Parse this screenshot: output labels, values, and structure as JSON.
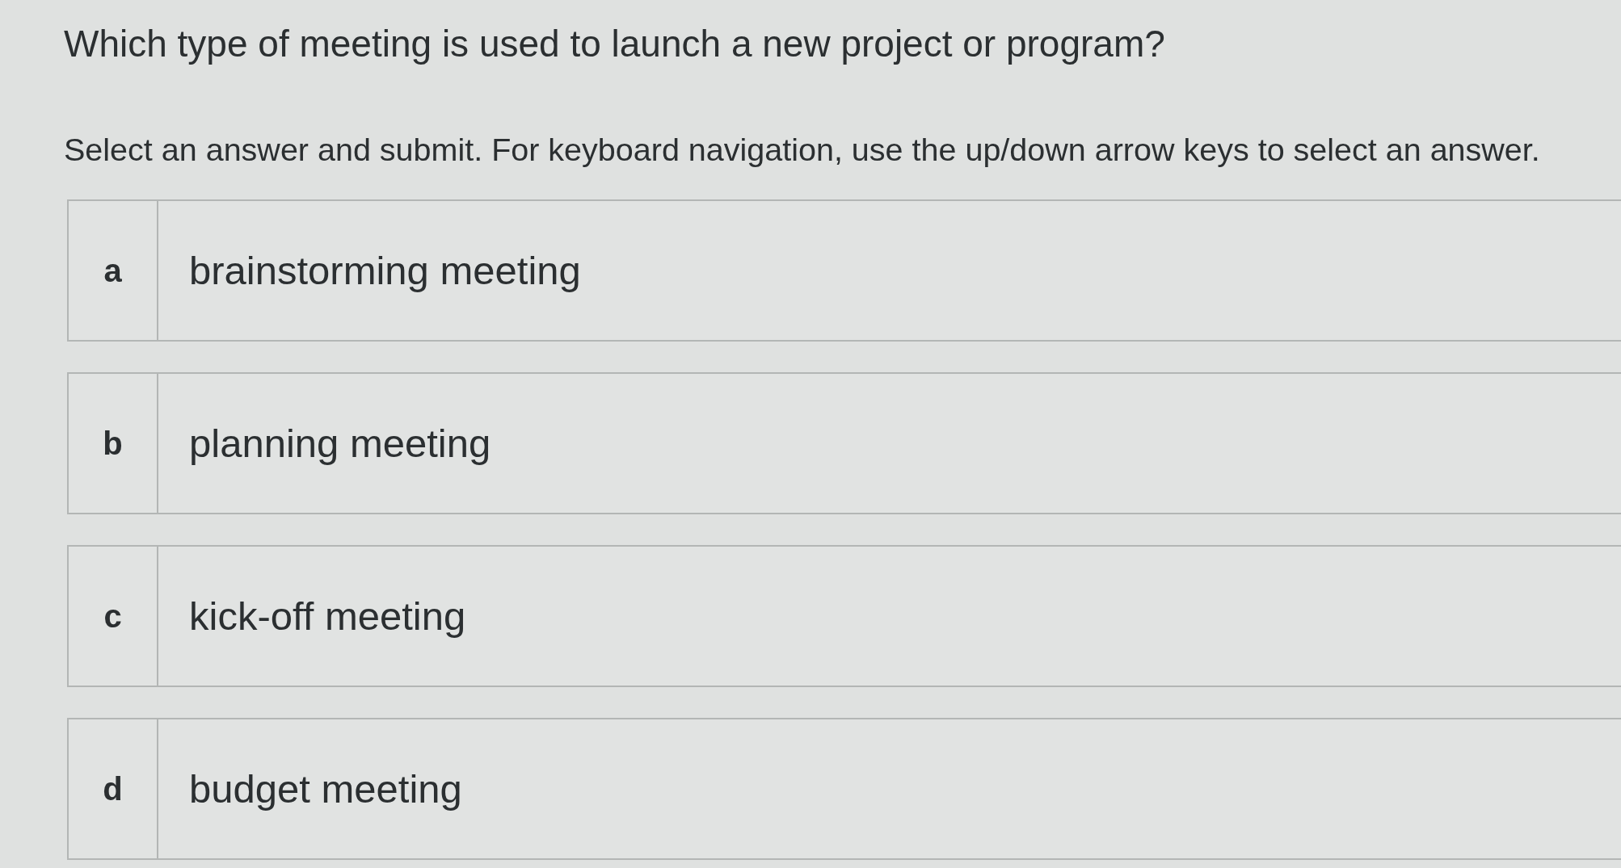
{
  "question": {
    "title": "Which type of meeting is used to launch a new project or program?",
    "instructions": "Select an answer and submit. For keyboard navigation, use the up/down arrow keys to select an answer."
  },
  "options": [
    {
      "letter": "a",
      "text": "brainstorming meeting",
      "selected": false
    },
    {
      "letter": "b",
      "text": "planning meeting",
      "selected": false
    },
    {
      "letter": "c",
      "text": "kick-off meeting",
      "selected": false
    },
    {
      "letter": "d",
      "text": "budget meeting",
      "selected": false
    }
  ]
}
